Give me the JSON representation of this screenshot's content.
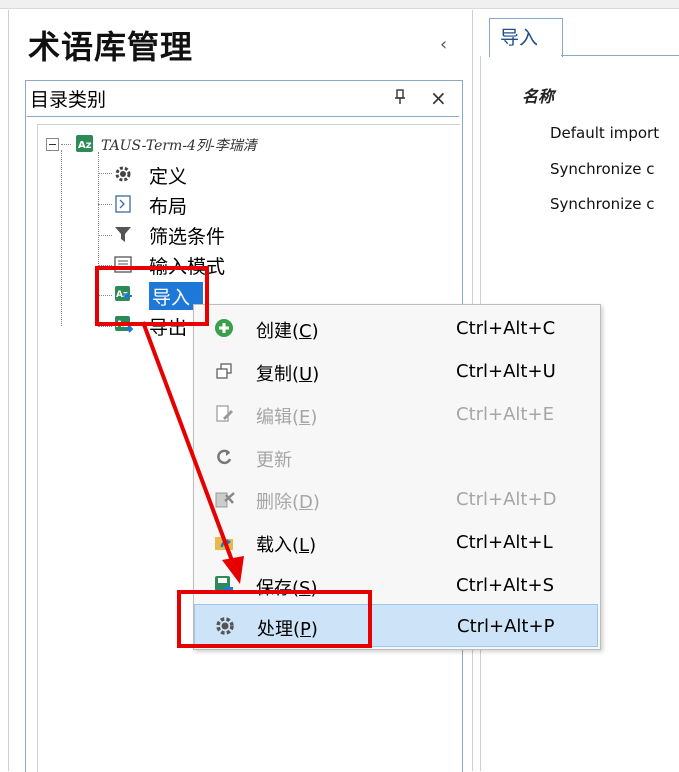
{
  "panel": {
    "title": "术语库管理",
    "collapse_glyph": "‹"
  },
  "tree_header": {
    "label": "目录类别",
    "pin_glyph": "ᘂ",
    "close_glyph": "×"
  },
  "tree": {
    "root": {
      "label": "TAUS-Term-4列-李瑞清",
      "icon": "termbase-icon"
    },
    "children": [
      {
        "label": "定义",
        "icon": "gear-icon"
      },
      {
        "label": "布局",
        "icon": "layout-icon"
      },
      {
        "label": "筛选条件",
        "icon": "filter-icon"
      },
      {
        "label": "输入模式",
        "icon": "input-model-icon"
      },
      {
        "label": "导入",
        "icon": "import-icon",
        "selected": true
      },
      {
        "label": "导出",
        "icon": "export-icon"
      }
    ]
  },
  "right_panel": {
    "tab_label": "导入",
    "column_header": "名称",
    "rows": [
      "Default import",
      "Synchronize c",
      "Synchronize c"
    ]
  },
  "context_menu": {
    "items": [
      {
        "label_pre": "创建(",
        "key": "C",
        "label_post": ")",
        "shortcut": "Ctrl+Alt+C",
        "icon": "plus-circle-icon",
        "disabled": false
      },
      {
        "label_pre": "复制(",
        "key": "U",
        "label_post": ")",
        "shortcut": "Ctrl+Alt+U",
        "icon": "copy-icon",
        "disabled": false
      },
      {
        "label_pre": "编辑(",
        "key": "E",
        "label_post": ")",
        "shortcut": "Ctrl+Alt+E",
        "icon": "edit-icon",
        "disabled": true
      },
      {
        "label_pre": "更新",
        "key": "",
        "label_post": "",
        "shortcut": "",
        "icon": "refresh-icon",
        "disabled": true
      },
      {
        "label_pre": "删除(",
        "key": "D",
        "label_post": ")",
        "shortcut": "Ctrl+Alt+D",
        "icon": "delete-icon",
        "disabled": true
      },
      {
        "label_pre": "载入(",
        "key": "L",
        "label_post": ")",
        "shortcut": "Ctrl+Alt+L",
        "icon": "load-icon",
        "disabled": false
      },
      {
        "label_pre": "保存(",
        "key": "S",
        "label_post": ")",
        "shortcut": "Ctrl+Alt+S",
        "icon": "save-icon",
        "disabled": false
      },
      {
        "label_pre": "处理(",
        "key": "P",
        "label_post": ")",
        "shortcut": "Ctrl+Alt+P",
        "icon": "process-gear-icon",
        "disabled": false,
        "highlighted": true
      }
    ]
  },
  "colors": {
    "accent_blue": "#1e78d7",
    "annotation_red": "#e60000",
    "highlight_bg": "#cde3f7",
    "disabled_text": "#a6a6a6"
  }
}
